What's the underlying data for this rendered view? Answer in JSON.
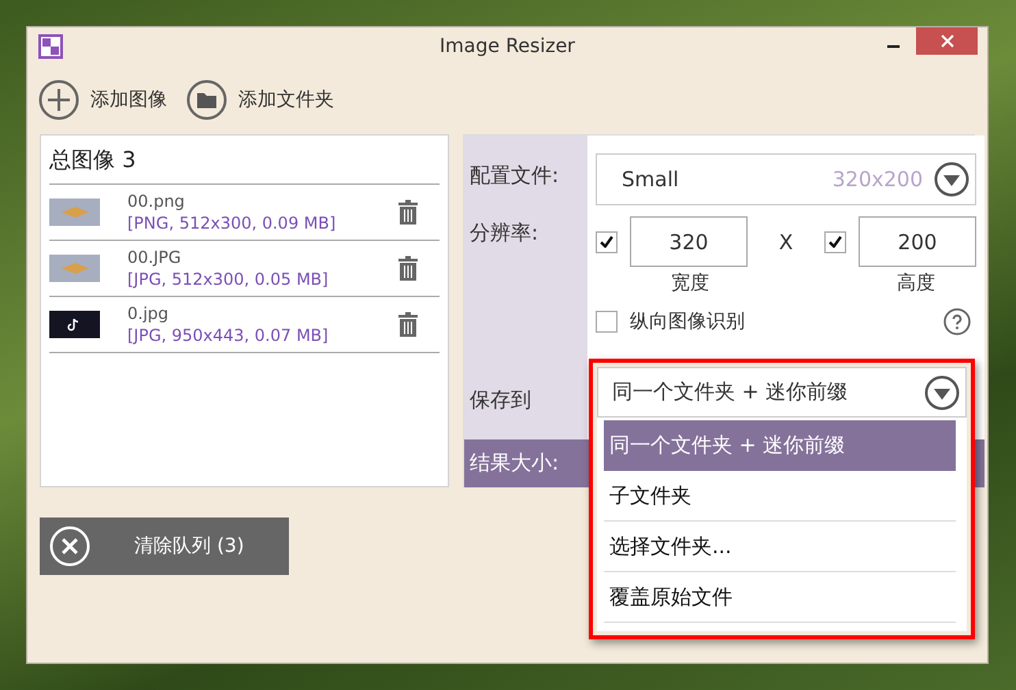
{
  "window": {
    "title": "Image Resizer"
  },
  "toolbar": [
    {
      "label": "添加图像",
      "kind": "add"
    },
    {
      "label": "添加文件夹",
      "kind": "folder"
    }
  ],
  "queue": {
    "title": "总图像 3",
    "files": [
      {
        "name": "00.png",
        "info": "[PNG, 512x300, 0.09 MB]",
        "kind": "light"
      },
      {
        "name": "00.JPG",
        "info": "[JPG, 512x300, 0.05 MB]",
        "kind": "light"
      },
      {
        "name": "0.jpg",
        "info": "[JPG, 950x443, 0.07 MB]",
        "kind": "dark"
      }
    ]
  },
  "settings": {
    "profile": {
      "label": "配置文件:",
      "value": "Small",
      "size": "320x200"
    },
    "resolution": {
      "label": "分辨率:",
      "separator": "X",
      "width": {
        "value": "320",
        "caption": "宽度",
        "checked": true
      },
      "height": {
        "value": "200",
        "caption": "高度",
        "checked": true
      }
    },
    "portrait": {
      "label": "纵向图像识别",
      "checked": false
    },
    "save_to": {
      "label": "保存到",
      "value": "同一个文件夹 + 迷你前缀",
      "expanded": true,
      "options": [
        {
          "label": "同一个文件夹 + 迷你前缀",
          "selected": true
        },
        {
          "label": "子文件夹",
          "selected": false
        },
        {
          "label": "选择文件夹...",
          "selected": false
        },
        {
          "label": "覆盖原始文件",
          "selected": false
        }
      ]
    },
    "result_size": {
      "label": "结果大小:"
    }
  },
  "clear_button": {
    "label": "清除队列 (3)"
  }
}
